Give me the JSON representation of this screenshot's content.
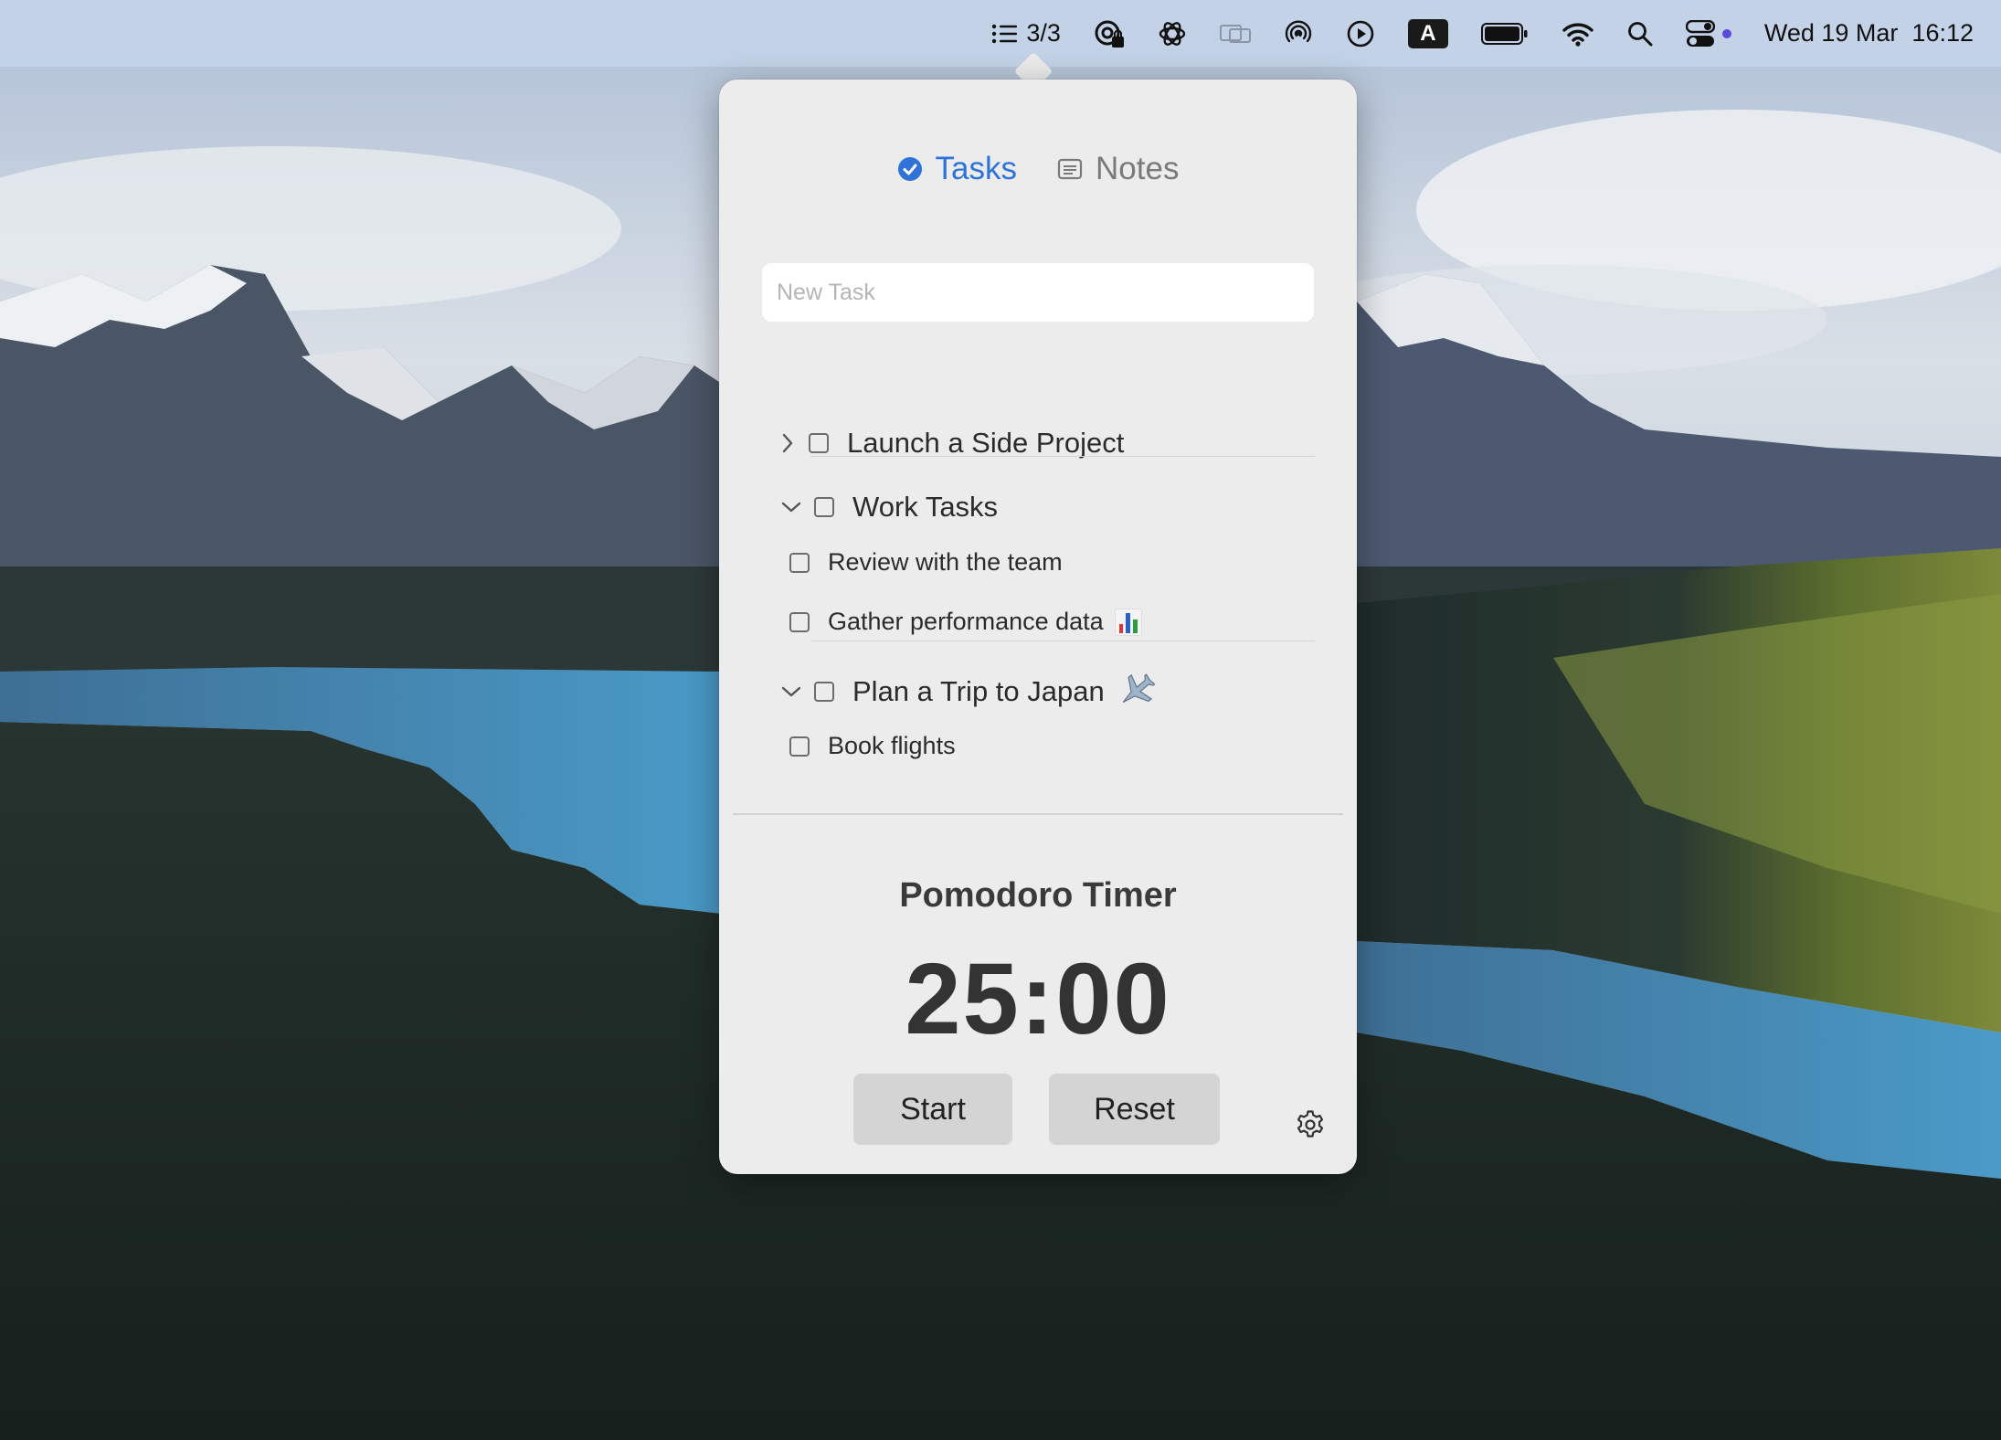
{
  "menubar": {
    "task_count": "3/3",
    "input_source": "A",
    "datetime": "Wed 19 Mar  16:12",
    "icons": [
      "list-icon",
      "password-lock-icon",
      "chatgpt-icon",
      "display-icon",
      "airdrop-icon",
      "play-circle-icon",
      "input-source-icon",
      "battery-icon",
      "wifi-icon",
      "search-icon",
      "control-center-icon"
    ]
  },
  "tabs": [
    {
      "label": "Tasks",
      "icon": "checkmark-circle-icon",
      "active": true
    },
    {
      "label": "Notes",
      "icon": "note-icon",
      "active": false
    }
  ],
  "new_task": {
    "placeholder": "New Task",
    "value": ""
  },
  "tasks": [
    {
      "title": "Launch a Side Project",
      "expanded": false,
      "checked": false,
      "subtasks": []
    },
    {
      "title": "Work Tasks",
      "expanded": true,
      "checked": false,
      "subtasks": [
        {
          "title": "Review with the team",
          "checked": false
        },
        {
          "title": "Gather performance data",
          "emoji": "bar-chart-icon",
          "checked": false
        }
      ]
    },
    {
      "title": "Plan a Trip to Japan",
      "emoji": "airplane-icon",
      "expanded": true,
      "checked": false,
      "subtasks": [
        {
          "title": "Book flights",
          "checked": false
        }
      ]
    }
  ],
  "timer": {
    "title": "Pomodoro Timer",
    "value": "25:00",
    "start_label": "Start",
    "reset_label": "Reset"
  },
  "colors": {
    "accent": "#2f73d9",
    "popover_bg": "#ececec",
    "button_bg": "#d4d4d4",
    "menubar_bg": "#c4d4e8"
  }
}
